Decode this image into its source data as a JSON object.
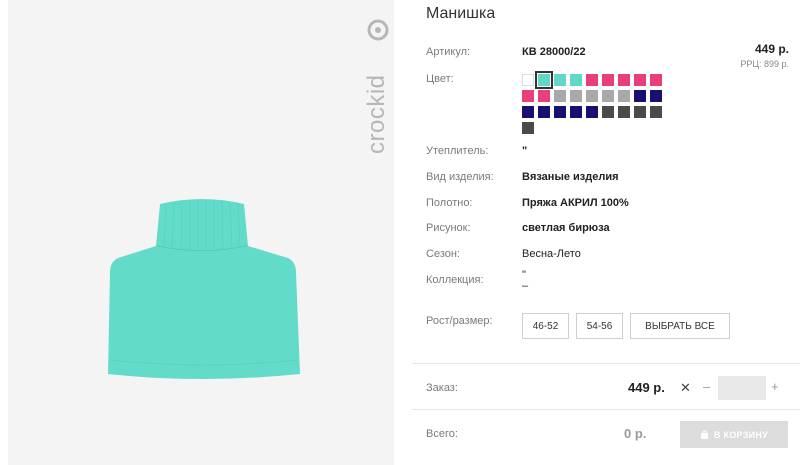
{
  "product": {
    "title": "Манишка",
    "brand": "crockid",
    "price": "449 р.",
    "rrp": "РРЦ: 899 р."
  },
  "attributes": {
    "article_label": "Артикул:",
    "article_value": "КВ 28000/22",
    "color_label": "Цвет:",
    "insulation_label": "Утеплитель:",
    "insulation_value": "\"",
    "type_label": "Вид изделия:",
    "type_value": "Вязаные изделия",
    "fabric_label": "Полотно:",
    "fabric_value": "Пряжа АКРИЛ 100%",
    "pattern_label": "Рисунок:",
    "pattern_value": "светлая бирюза",
    "season_label": "Сезон:",
    "season_value": "Весна-Лето",
    "collection_label": "Коллекция:",
    "collection_value_1": "\"",
    "collection_value_2": "–"
  },
  "colors": [
    {
      "hex": "#ffffff",
      "selected": false
    },
    {
      "hex": "#5fd8c8",
      "selected": true
    },
    {
      "hex": "#5fd8c8",
      "selected": false
    },
    {
      "hex": "#5fd8c8",
      "selected": false
    },
    {
      "hex": "#e8407c",
      "selected": false
    },
    {
      "hex": "#e8407c",
      "selected": false
    },
    {
      "hex": "#e8407c",
      "selected": false
    },
    {
      "hex": "#e8407c",
      "selected": false
    },
    {
      "hex": "#e8407c",
      "selected": false
    },
    {
      "hex": "#e8407c",
      "selected": false
    },
    {
      "hex": "#e8407c",
      "selected": false
    },
    {
      "hex": "#a8a8a8",
      "selected": false
    },
    {
      "hex": "#a8a8a8",
      "selected": false
    },
    {
      "hex": "#a8a8a8",
      "selected": false
    },
    {
      "hex": "#a8a8a8",
      "selected": false
    },
    {
      "hex": "#a8a8a8",
      "selected": false
    },
    {
      "hex": "#1a1070",
      "selected": false
    },
    {
      "hex": "#1a1070",
      "selected": false
    },
    {
      "hex": "#1a1070",
      "selected": false
    },
    {
      "hex": "#1a1070",
      "selected": false
    },
    {
      "hex": "#1a1070",
      "selected": false
    },
    {
      "hex": "#1a1070",
      "selected": false
    },
    {
      "hex": "#1a1070",
      "selected": false
    },
    {
      "hex": "#4a4a4a",
      "selected": false
    },
    {
      "hex": "#4a4a4a",
      "selected": false
    },
    {
      "hex": "#4a4a4a",
      "selected": false
    },
    {
      "hex": "#4a4a4a",
      "selected": false
    },
    {
      "hex": "#4a4a4a",
      "selected": false
    }
  ],
  "sizes": {
    "label": "Рост/размер:",
    "options": [
      "46-52",
      "54-56"
    ],
    "select_all": "ВЫБРАТЬ ВСЕ"
  },
  "order": {
    "label": "Заказ:",
    "price": "449 р.",
    "times": "✕",
    "minus": "–",
    "plus": "+",
    "quantity": ""
  },
  "total": {
    "label": "Всего:",
    "value": "0 р.",
    "cart_button": "В КОРЗИНУ"
  },
  "theme": {
    "product_color": "#62dcc9",
    "panel_bg": "#f4f4f4"
  }
}
